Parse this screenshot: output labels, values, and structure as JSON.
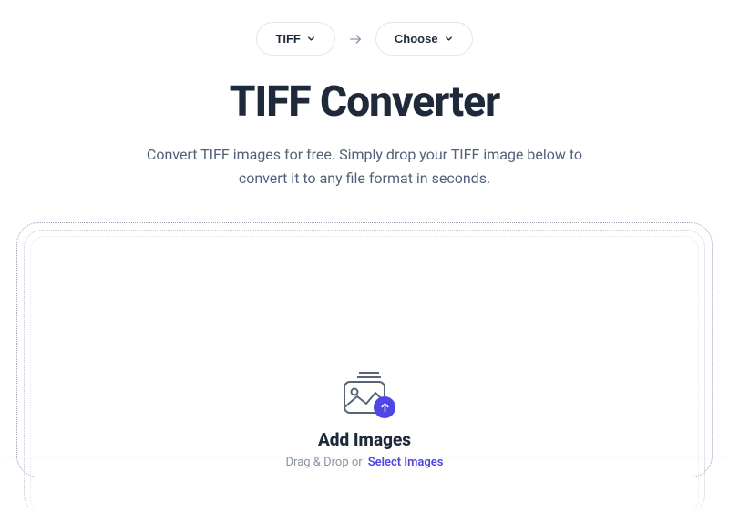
{
  "selectors": {
    "from_label": "TIFF",
    "to_label": "Choose"
  },
  "header": {
    "title": "TIFF Converter",
    "description": "Convert TIFF images for free. Simply drop your TIFF image below to convert it to any file format in seconds."
  },
  "dropzone": {
    "title": "Add Images",
    "dragdrop_text": "Drag & Drop or",
    "select_link": "Select Images"
  },
  "colors": {
    "accent": "#4f46e5",
    "text_primary": "#1e2a3a",
    "text_secondary": "#52607a"
  }
}
